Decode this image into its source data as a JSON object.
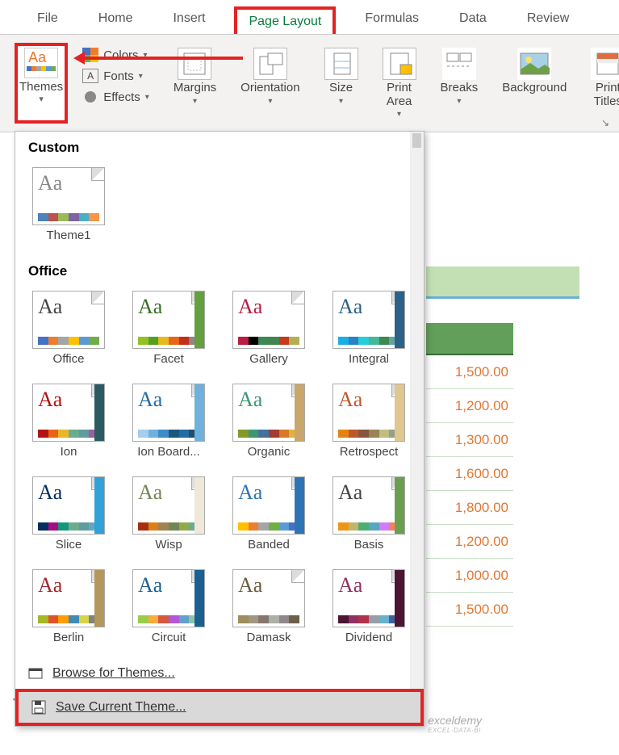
{
  "tabs": [
    "File",
    "Home",
    "Insert",
    "Page Layout",
    "Formulas",
    "Data",
    "Review"
  ],
  "ribbon": {
    "themes": {
      "label": "Themes"
    },
    "colors": "Colors",
    "fonts": "Fonts",
    "effects": "Effects",
    "margins": "Margins",
    "orientation": "Orientation",
    "size": "Size",
    "print_area": "Print\nArea",
    "breaks": "Breaks",
    "background": "Background",
    "print_titles": "Print\nTitles"
  },
  "dropdown": {
    "custom_header": "Custom",
    "office_header": "Office",
    "custom": [
      {
        "name": "Theme1",
        "p": [
          "#4f81bd",
          "#c0504d",
          "#9bbb59",
          "#8064a2",
          "#4bacc6",
          "#f79646"
        ],
        "aa": "#888"
      }
    ],
    "office": [
      {
        "name": "Office",
        "p": [
          "#4472c4",
          "#ed7d31",
          "#a5a5a5",
          "#ffc000",
          "#5b9bd5",
          "#70ad47"
        ],
        "aa": "#444"
      },
      {
        "name": "Facet",
        "p": [
          "#90c226",
          "#54a021",
          "#e6b91e",
          "#e76618",
          "#c42f1a",
          "#918485"
        ],
        "aa": "#3a6c28",
        "side": "#64a03e"
      },
      {
        "name": "Gallery",
        "p": [
          "#b71e42",
          "#000",
          "#3e8853",
          "#42854e",
          "#c73a1d",
          "#b5ae53"
        ],
        "aa": "#b71e42"
      },
      {
        "name": "Integral",
        "p": [
          "#1cade4",
          "#2683c6",
          "#27ced7",
          "#42ba97",
          "#3e8853",
          "#62a39f"
        ],
        "aa": "#2e6188",
        "side": "#2e6188"
      },
      {
        "name": "Ion",
        "p": [
          "#b01513",
          "#ea6312",
          "#e6b729",
          "#6aac90",
          "#5f9c9d",
          "#9e5e9b"
        ],
        "aa": "#b01513",
        "side": "#2b5a63"
      },
      {
        "name": "Ion Board...",
        "p": [
          "#a3ceee",
          "#6eb1dd",
          "#3e8bc6",
          "#1b587c",
          "#236ba6",
          "#214e69"
        ],
        "aa": "#236ba6",
        "side": "#6eb1dd"
      },
      {
        "name": "Organic",
        "p": [
          "#83992a",
          "#3c9770",
          "#44709d",
          "#a23c33",
          "#d97828",
          "#deb340"
        ],
        "aa": "#3c9770",
        "side": "#c9a66b"
      },
      {
        "name": "Retrospect",
        "p": [
          "#e48312",
          "#bd582c",
          "#865640",
          "#9b8357",
          "#c2bc80",
          "#94a088"
        ],
        "aa": "#bd582c",
        "side": "#e0c68f"
      },
      {
        "name": "Slice",
        "p": [
          "#052f61",
          "#a50e82",
          "#14967c",
          "#6aac91",
          "#5f9c9d",
          "#64a6c4"
        ],
        "aa": "#052f61",
        "side": "#30a2d8"
      },
      {
        "name": "Wisp",
        "p": [
          "#a53010",
          "#de7e18",
          "#9f8351",
          "#728653",
          "#92aa4c",
          "#6aac91"
        ],
        "aa": "#728653",
        "side": "#f0e8d8"
      },
      {
        "name": "Banded",
        "p": [
          "#ffc000",
          "#ed7d31",
          "#a5a5a5",
          "#70ad47",
          "#5b9bd5",
          "#4472c4"
        ],
        "aa": "#2e74b5",
        "side": "#2e74b5"
      },
      {
        "name": "Basis",
        "p": [
          "#f09415",
          "#c1b56b",
          "#4baf73",
          "#5aa6c0",
          "#d17df9",
          "#fa7e5c"
        ],
        "aa": "#444",
        "side": "#6a9f4f"
      },
      {
        "name": "Berlin",
        "p": [
          "#a6b727",
          "#df5327",
          "#fe9e00",
          "#418ab3",
          "#d7d447",
          "#818183"
        ],
        "aa": "#a6272c",
        "side": "#b5975b"
      },
      {
        "name": "Circuit",
        "p": [
          "#9acd4c",
          "#faa93a",
          "#d35940",
          "#b258d3",
          "#63a0cc",
          "#8ac4a7"
        ],
        "aa": "#1a6091",
        "side": "#1a6091"
      },
      {
        "name": "Damask",
        "p": [
          "#9e8e5c",
          "#a09781",
          "#85776d",
          "#aeafa9",
          "#8d878b",
          "#6b6149"
        ],
        "aa": "#6b5b3d"
      },
      {
        "name": "Dividend",
        "p": [
          "#4d1434",
          "#903163",
          "#b2324b",
          "#969fa7",
          "#66b1ce",
          "#40619d"
        ],
        "aa": "#903163",
        "side": "#4d1434"
      }
    ],
    "browse": "Browse for Themes...",
    "save": "Save Current Theme..."
  },
  "cells": [
    "1,500.00",
    "1,200.00",
    "1,300.00",
    "1,600.00",
    "1,800.00",
    "1,200.00",
    "1,000.00",
    "1,500.00"
  ],
  "watermark": {
    "main": "exceldemy",
    "sub": "EXCEL·DATA·BI"
  }
}
